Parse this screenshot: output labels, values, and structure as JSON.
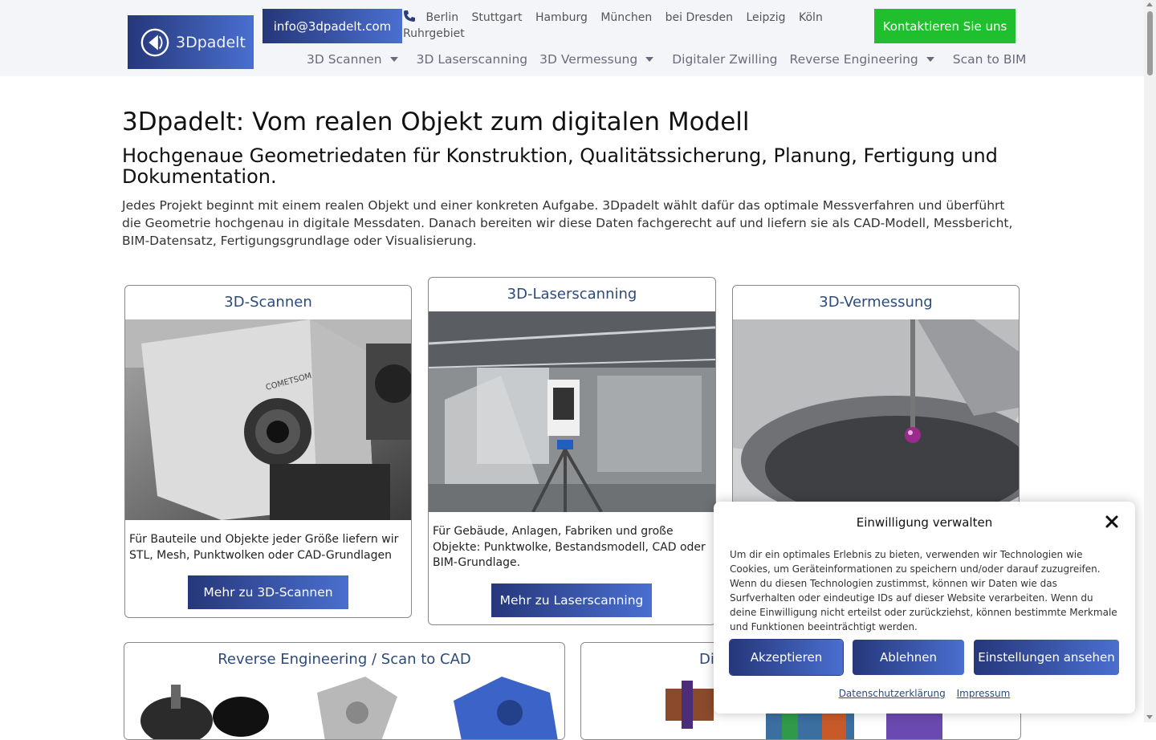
{
  "header": {
    "logo_text": "3Dpadelt",
    "email": "info@3dpadelt.com",
    "cities": [
      "Berlin",
      "Stuttgart",
      "Hamburg",
      "München",
      "bei Dresden",
      "Leipzig",
      "Köln",
      "Ruhrgebiet"
    ],
    "contact_button": "Kontaktieren Sie uns",
    "nav": [
      {
        "label": "3D Scannen",
        "has_dropdown": true
      },
      {
        "label": "3D Laserscanning",
        "has_dropdown": false
      },
      {
        "label": "3D Vermessung",
        "has_dropdown": true
      },
      {
        "label": "Digitaler Zwilling",
        "has_dropdown": false
      },
      {
        "label": "Reverse Engineering",
        "has_dropdown": true
      },
      {
        "label": "Scan to BIM",
        "has_dropdown": false
      }
    ]
  },
  "main": {
    "title": "3Dpadelt: Vom realen Objekt zum digitalen Modell",
    "subtitle": "Hochgenaue Geometriedaten für Konstruktion, Qualitätssicherung, Planung, Fertigung und Dokumentation.",
    "intro": "Jedes Projekt beginnt mit einem realen Objekt und einer konkreten Aufgabe. 3Dpadelt wählt dafür das optimale Messverfahren und überführt die Geometrie hochgenau in digitale Messdaten. Danach bereiten wir diese Daten fachgerecht auf und liefern sie als CAD-Modell, Messbericht, BIM-Datensatz, Fertigungsgrundlage oder Visualisierung."
  },
  "cards": [
    {
      "title": "3D-Scannen",
      "text": "Für Bauteile und Objekte jeder Größe liefern wir STL, Mesh, Punktwolken oder CAD-Grundlagen",
      "button": "Mehr zu 3D-Scannen",
      "image_label": "COMETSOM"
    },
    {
      "title": "3D-Laserscanning",
      "text": "Für Gebäude, Anlagen, Fabriken und große Objekte: Punktwolke, Bestandsmodell, CAD oder BIM-Grundlage.",
      "button": "Mehr zu Laserscanning"
    },
    {
      "title": "3D-Vermessung"
    },
    {
      "title": "Reverse Engineering / Scan to CAD"
    },
    {
      "title": "Di"
    }
  ],
  "consent": {
    "title": "Einwilligung verwalten",
    "text": "Um dir ein optimales Erlebnis zu bieten, verwenden wir Technologien wie Cookies, um Geräteinformationen zu speichern und/oder darauf zuzugreifen. Wenn du diesen Technologien zustimmst, können wir Daten wie das Surfverhalten oder eindeutige IDs auf dieser Website verarbeiten. Wenn du deine Einwilligung nicht erteilst oder zurückziehst, können bestimmte Merkmale und Funktionen beeinträchtigt werden.",
    "accept": "Akzeptieren",
    "reject": "Ablehnen",
    "settings": "Einstellungen ansehen",
    "privacy_link": "Datenschutzerklärung",
    "imprint_link": "Impressum"
  },
  "colors": {
    "brand_gradient_start": "#26377a",
    "brand_gradient_end": "#4a6fd0",
    "contact_green": "#1fbf2e",
    "card_title": "#2c4a7c"
  }
}
